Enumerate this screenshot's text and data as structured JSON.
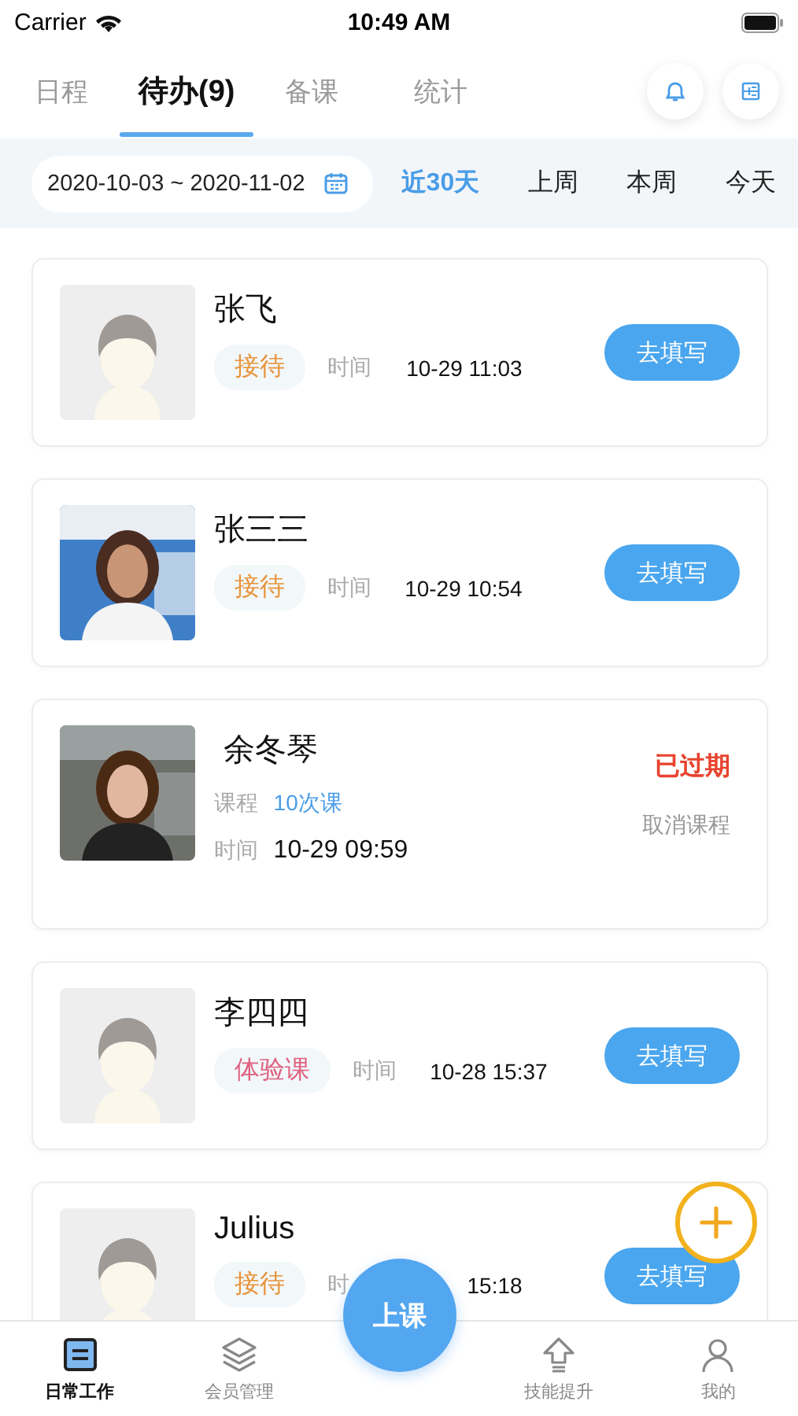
{
  "status_bar": {
    "carrier": "Carrier",
    "time": "10:49 AM"
  },
  "tabs": [
    {
      "label": "日程",
      "selected": false
    },
    {
      "label": "待办(9)",
      "selected": true
    },
    {
      "label": "备课",
      "selected": false
    },
    {
      "label": "统计",
      "selected": false
    }
  ],
  "date_range": {
    "value": "2020-10-03 ~ 2020-11-02"
  },
  "quick_filters": [
    {
      "label": "近30天",
      "selected": true
    },
    {
      "label": "上周",
      "selected": false
    },
    {
      "label": "本周",
      "selected": false
    },
    {
      "label": "今天",
      "selected": false
    }
  ],
  "cards": [
    {
      "kind": "todo",
      "has_photo": false,
      "name": "张飞",
      "tag": {
        "label": "接待",
        "color": "#e8943a"
      },
      "time_label": "时间",
      "time": "10-29 11:03",
      "action": "去填写"
    },
    {
      "kind": "todo",
      "has_photo": true,
      "name": "张三三",
      "tag": {
        "label": "接待",
        "color": "#e8943a"
      },
      "time_label": "时间",
      "time": "10-29 10:54",
      "action": "去填写"
    },
    {
      "kind": "course",
      "has_photo": true,
      "name": "余冬琴",
      "course_label": "课程",
      "course": "10次课",
      "time_label": "时间",
      "time": "10-29 09:59",
      "status": "已过期",
      "action": "取消课程"
    },
    {
      "kind": "todo",
      "has_photo": false,
      "name": "李四四",
      "tag": {
        "label": "体验课",
        "color": "#e0607e"
      },
      "time_label": "时间",
      "time": "10-28 15:37",
      "action": "去填写"
    },
    {
      "kind": "todo",
      "has_photo": false,
      "name": "Julius",
      "tag": {
        "label": "接待",
        "color": "#e8943a"
      },
      "time_label": "时",
      "time": "15:18",
      "action": "去填写"
    }
  ],
  "center_button": {
    "label": "上课"
  },
  "bottom_nav": [
    {
      "label": "日常工作",
      "selected": true
    },
    {
      "label": "会员管理",
      "selected": false
    },
    {
      "label": "技能提升",
      "selected": false
    },
    {
      "label": "我的",
      "selected": false
    }
  ]
}
